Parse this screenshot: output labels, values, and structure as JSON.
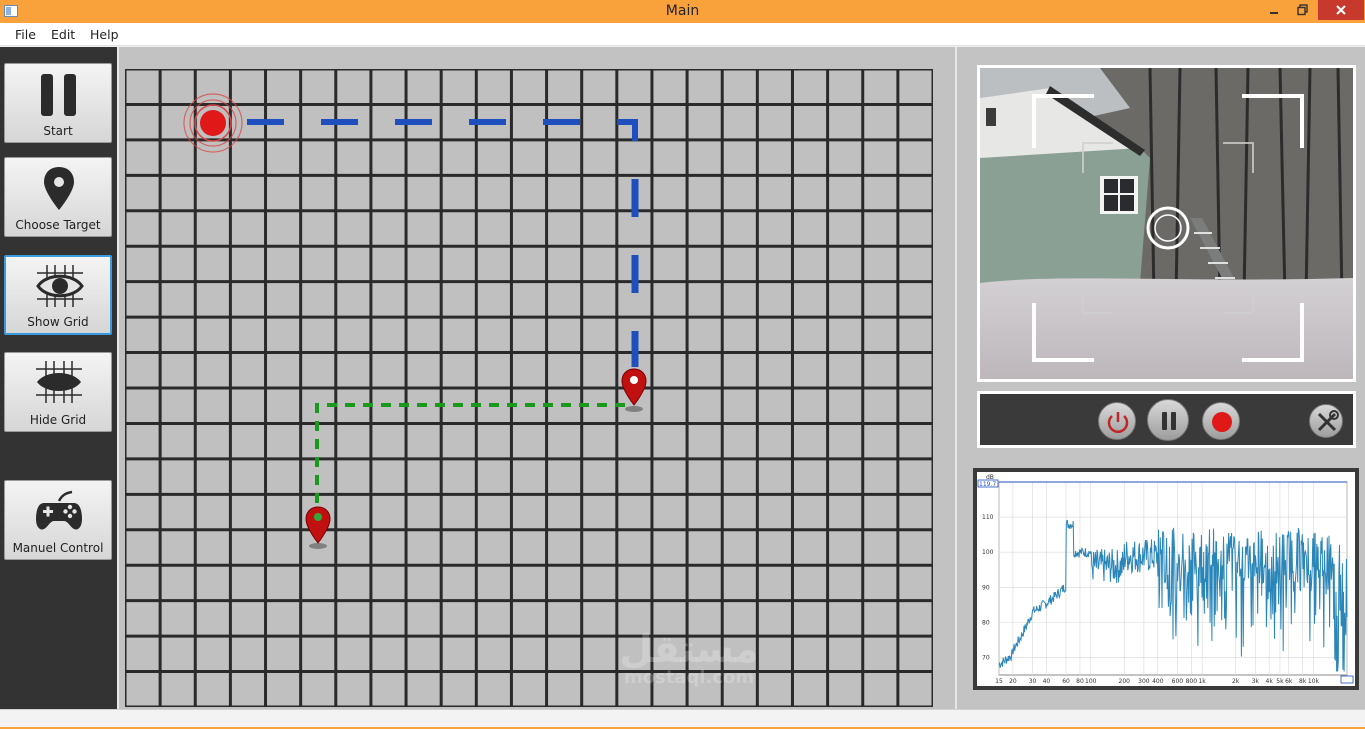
{
  "window": {
    "title": "Main",
    "min_icon": "minimize-icon",
    "max_icon": "restore-icon",
    "close_icon": "close-icon"
  },
  "menu": [
    {
      "label": "File"
    },
    {
      "label": "Edit"
    },
    {
      "label": "Help"
    }
  ],
  "sidebar": {
    "buttons": [
      {
        "label": "Start",
        "icon": "pause-icon"
      },
      {
        "label": "Choose Target",
        "icon": "map-pin-icon"
      },
      {
        "label": "Show Grid",
        "icon": "eye-grid-icon",
        "active": true
      },
      {
        "label": "Hide Grid",
        "icon": "eye-closed-grid-icon"
      },
      {
        "label": "Manuel Control",
        "icon": "gamepad-icon"
      }
    ]
  },
  "grid": {
    "columns": 23,
    "rows": 18,
    "robot_cell": [
      2,
      1
    ],
    "blue_path_color": "#1f4fbf",
    "green_path_color": "#1a9a1a",
    "target_color": "#c01010",
    "watermark": {
      "text": "مستقل",
      "sub": "mostaql.com"
    }
  },
  "camera": {
    "controls": [
      {
        "icon": "power-icon"
      },
      {
        "icon": "pause-icon"
      },
      {
        "icon": "record-icon"
      },
      {
        "icon": "settings-tools-icon"
      }
    ]
  },
  "spectrum": {
    "unit_label": "dB",
    "top_value": "119.7",
    "y_ticks": [
      "110",
      "100",
      "90",
      "80",
      "70"
    ],
    "x_ticks": [
      "15",
      "20",
      "30",
      "40",
      "60",
      "80",
      "100",
      "200",
      "300",
      "400",
      "600",
      "800",
      "1k",
      "2k",
      "3k",
      "4k",
      "5k",
      "6k",
      "8k",
      "10k",
      "20k"
    ],
    "x_end": "20k",
    "line_color": "#2a86b8"
  }
}
